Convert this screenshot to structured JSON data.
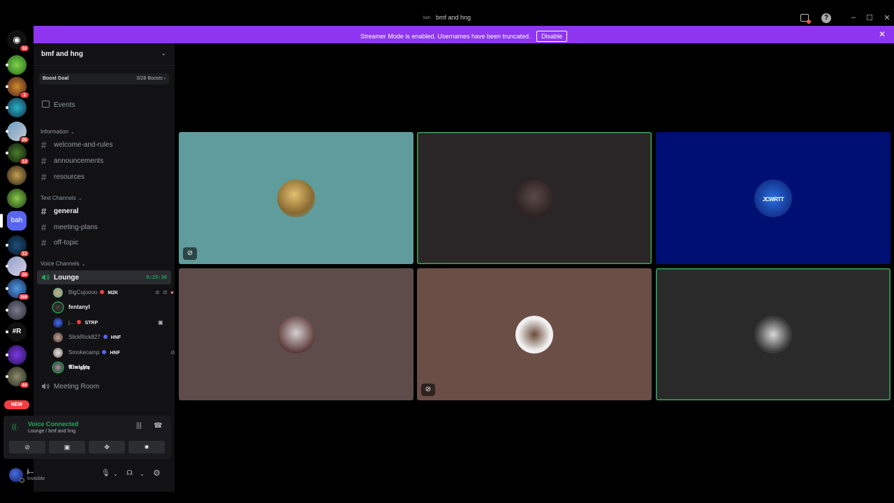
{
  "window": {
    "icon_text": "bah",
    "title": "bmf and hng"
  },
  "banner": {
    "message": "Streamer Mode is enabled. Usernames have been truncated.",
    "disable_label": "Disable"
  },
  "rail": {
    "dm_badge": "18",
    "badges": [
      "3",
      "26",
      "14",
      "13",
      "26",
      "369",
      "44"
    ],
    "active_server_label": "bah",
    "hash_r_label": "#R",
    "new_label": "NEW"
  },
  "guild": {
    "name": "bmf and hng",
    "boost_goal_label": "Boost Goal",
    "boost_progress": "0/28 Boosts ›",
    "events_label": "Events"
  },
  "categories": {
    "information": "Information",
    "text": "Text Channels",
    "voice": "Voice Channels"
  },
  "channels": {
    "info": [
      "welcome-and-rules",
      "announcements",
      "resources"
    ],
    "text": [
      "general",
      "meeting-plans",
      "off-topic"
    ],
    "voice_active": "Lounge",
    "voice_timer": "9:25:30",
    "voice_other": "Meeting Room"
  },
  "voice_users": [
    {
      "name": "BigCujoooo",
      "tag": "M2K",
      "tag_color": "#f23f42"
    },
    {
      "name": "fentanyl",
      "tag": "",
      "tag_color": ""
    },
    {
      "name": "j...",
      "tag": "STRP",
      "tag_color": "#f23f42"
    },
    {
      "name": "SlickRick827",
      "tag": "HNF",
      "tag_color": "#5865f2"
    },
    {
      "name": "Smokecamp",
      "tag": "HNF",
      "tag_color": "#5865f2"
    },
    {
      "name": "𝕬𝖑𝖒𝖎𝖌𝖍𝖙𝖞",
      "tag": "",
      "tag_color": ""
    }
  ],
  "voice_panel": {
    "status": "Voice Connected",
    "location": "Lounge / bmf and hng"
  },
  "user_panel": {
    "username": "j...",
    "status": "Invisible"
  },
  "video_tiles": [
    {
      "bg": "#5f9c9b",
      "speaking": false,
      "muted": true
    },
    {
      "bg": "#2a2526",
      "speaking": true,
      "muted": false
    },
    {
      "bg": "#000f72",
      "speaking": false,
      "muted": false,
      "avatar_text": "JCWRTT"
    },
    {
      "bg": "#5e4c4b",
      "speaking": false,
      "muted": false
    },
    {
      "bg": "#6b4f47",
      "speaking": false,
      "muted": true
    },
    {
      "bg": "#2a2a2a",
      "speaking": true,
      "muted": false
    }
  ],
  "colors": {
    "accent": "#8f35f0",
    "speaking_green": "#23a55a",
    "badge_red": "#f23f42"
  }
}
